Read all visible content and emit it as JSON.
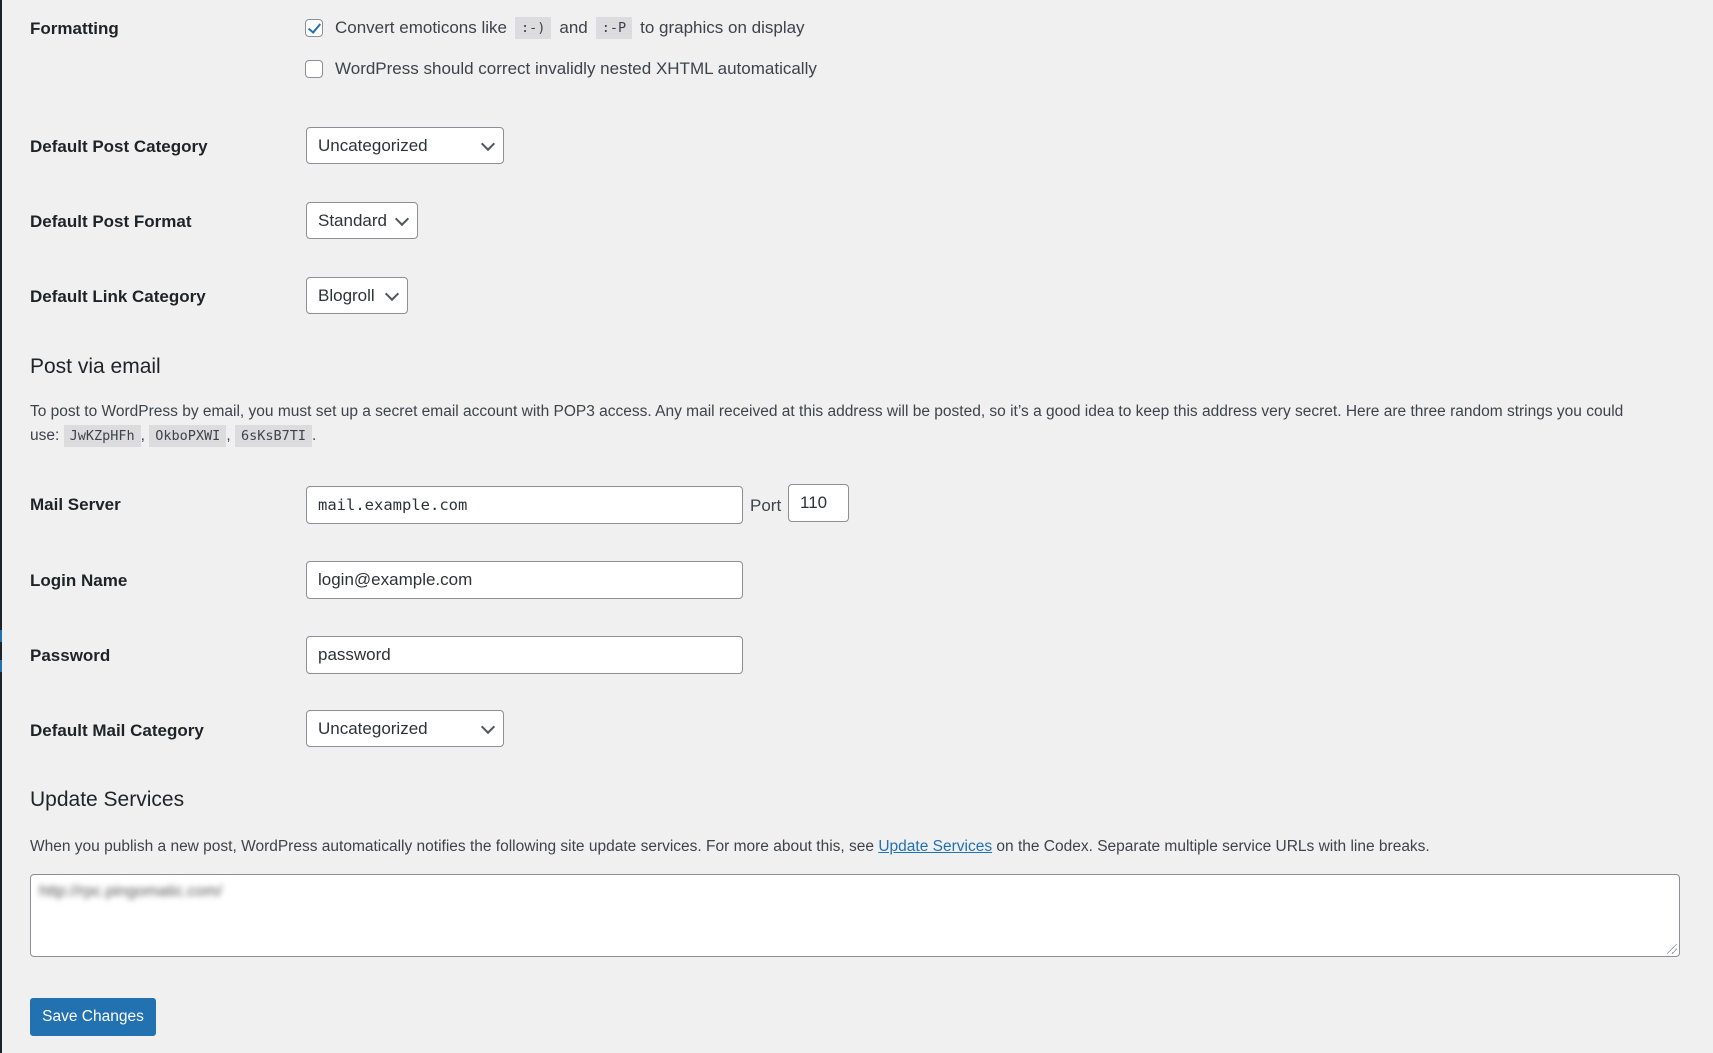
{
  "formatting": {
    "label": "Formatting",
    "options": [
      {
        "checked": true,
        "text_before": "Convert emoticons like",
        "code1": ":-)",
        "text_mid": "and",
        "code2": ":-P",
        "text_after": "to graphics on display"
      },
      {
        "checked": false,
        "text": "WordPress should correct invalidly nested XHTML automatically"
      }
    ]
  },
  "default_post_category": {
    "label": "Default Post Category",
    "value": "Uncategorized"
  },
  "default_post_format": {
    "label": "Default Post Format",
    "value": "Standard"
  },
  "default_link_category": {
    "label": "Default Link Category",
    "value": "Blogroll"
  },
  "post_via_email": {
    "heading": "Post via email",
    "description": "To post to WordPress by email, you must set up a secret email account with POP3 access. Any mail received at this address will be posted, so it’s a good idea to keep this address very secret. Here are three random strings you could",
    "use_prefix": "use:",
    "random_strings": [
      "JwKZpHFh",
      "OkboPXWI",
      "6sKsB7TI"
    ],
    "mail_server": {
      "label": "Mail Server",
      "value": "mail.example.com"
    },
    "port": {
      "label": "Port",
      "value": "110"
    },
    "login_name": {
      "label": "Login Name",
      "value": "login@example.com"
    },
    "password": {
      "label": "Password",
      "value": "password"
    },
    "default_mail_category": {
      "label": "Default Mail Category",
      "value": "Uncategorized"
    }
  },
  "update_services": {
    "heading": "Update Services",
    "description_before": "When you publish a new post, WordPress automatically notifies the following site update services. For more about this, see",
    "link_text": "Update Services",
    "description_after": "on the Codex. Separate multiple service URLs with line breaks.",
    "textarea_value": "http://rpc.pingomatic.com/"
  },
  "save_button": {
    "label": "Save Changes"
  },
  "colors": {
    "accent": "#2271b1",
    "background": "#f0f0f1",
    "text": "#1d2327"
  }
}
